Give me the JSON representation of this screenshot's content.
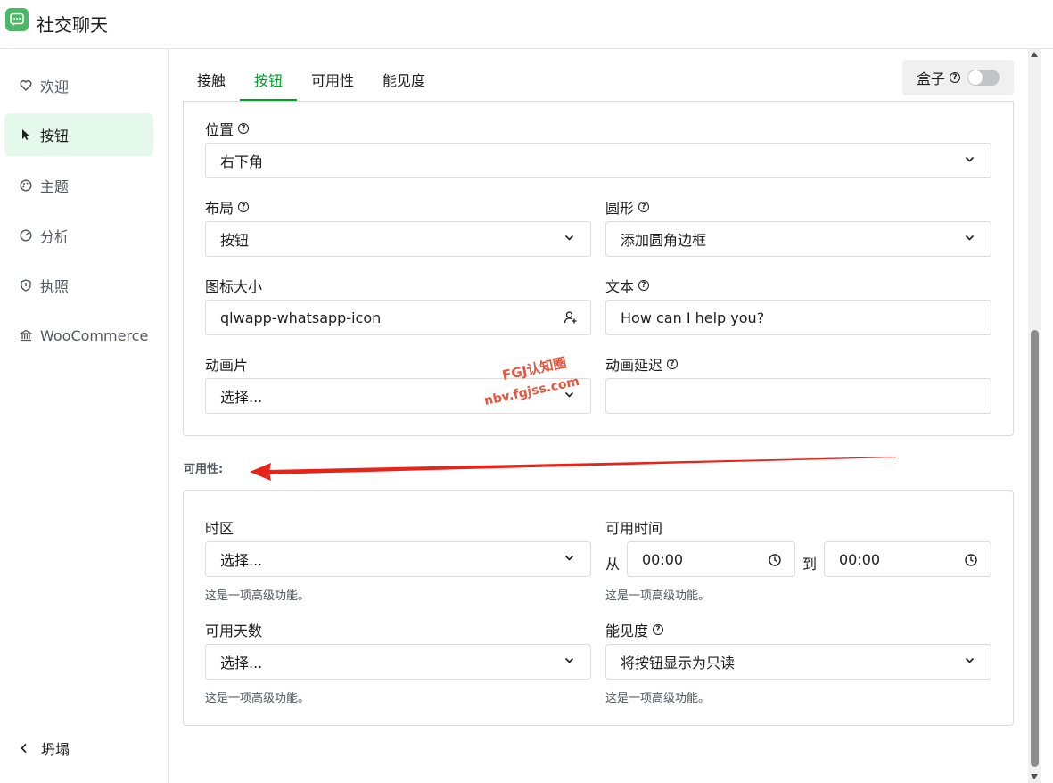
{
  "app": {
    "title": "社交聊天"
  },
  "sidebar": {
    "items": [
      {
        "label": "欢迎",
        "icon": "heart-icon"
      },
      {
        "label": "按钮",
        "icon": "cursor-icon"
      },
      {
        "label": "主题",
        "icon": "palette-icon"
      },
      {
        "label": "分析",
        "icon": "gauge-icon"
      },
      {
        "label": "执照",
        "icon": "shield-icon"
      },
      {
        "label": "WooCommerce",
        "icon": "bank-icon"
      }
    ],
    "active_index": 1,
    "collapse_label": "坍塌"
  },
  "tabs": [
    {
      "label": "接触"
    },
    {
      "label": "按钮"
    },
    {
      "label": "可用性"
    },
    {
      "label": "能见度"
    }
  ],
  "box_toggle": {
    "label": "盒子",
    "help": "?",
    "enabled": false
  },
  "button_panel": {
    "position": {
      "label": "位置",
      "value": "右下角"
    },
    "layout": {
      "label": "布局",
      "value": "按钮"
    },
    "rounded": {
      "label": "圆形",
      "value": "添加圆角边框"
    },
    "icon_size": {
      "label": "图标大小",
      "value": "qlwapp-whatsapp-icon"
    },
    "text": {
      "label": "文本",
      "value": "How can I help you?"
    },
    "animation": {
      "label": "动画片",
      "value": "选择..."
    },
    "animation_delay": {
      "label": "动画延迟",
      "value": ""
    }
  },
  "availability": {
    "section_title": "可用性:",
    "timezone": {
      "label": "时区",
      "value": "选择...",
      "hint": "这是一项高级功能。"
    },
    "available_time": {
      "label": "可用时间",
      "from_label": "从",
      "from_value": "00:00",
      "to_label": "到",
      "to_value": "00:00",
      "hint": "这是一项高级功能。"
    },
    "available_days": {
      "label": "可用天数",
      "value": "选择...",
      "hint": "这是一项高级功能。"
    },
    "visibility": {
      "label": "能见度",
      "value": "将按钮显示为只读",
      "hint": "这是一项高级功能。"
    }
  },
  "watermark": {
    "line1": "FGJ认知圈",
    "line2": "nbv.fgjss.com"
  },
  "colors": {
    "accent": "#00a32a",
    "active_bg": "#e5f8ec",
    "arrow": "#e8231a"
  }
}
